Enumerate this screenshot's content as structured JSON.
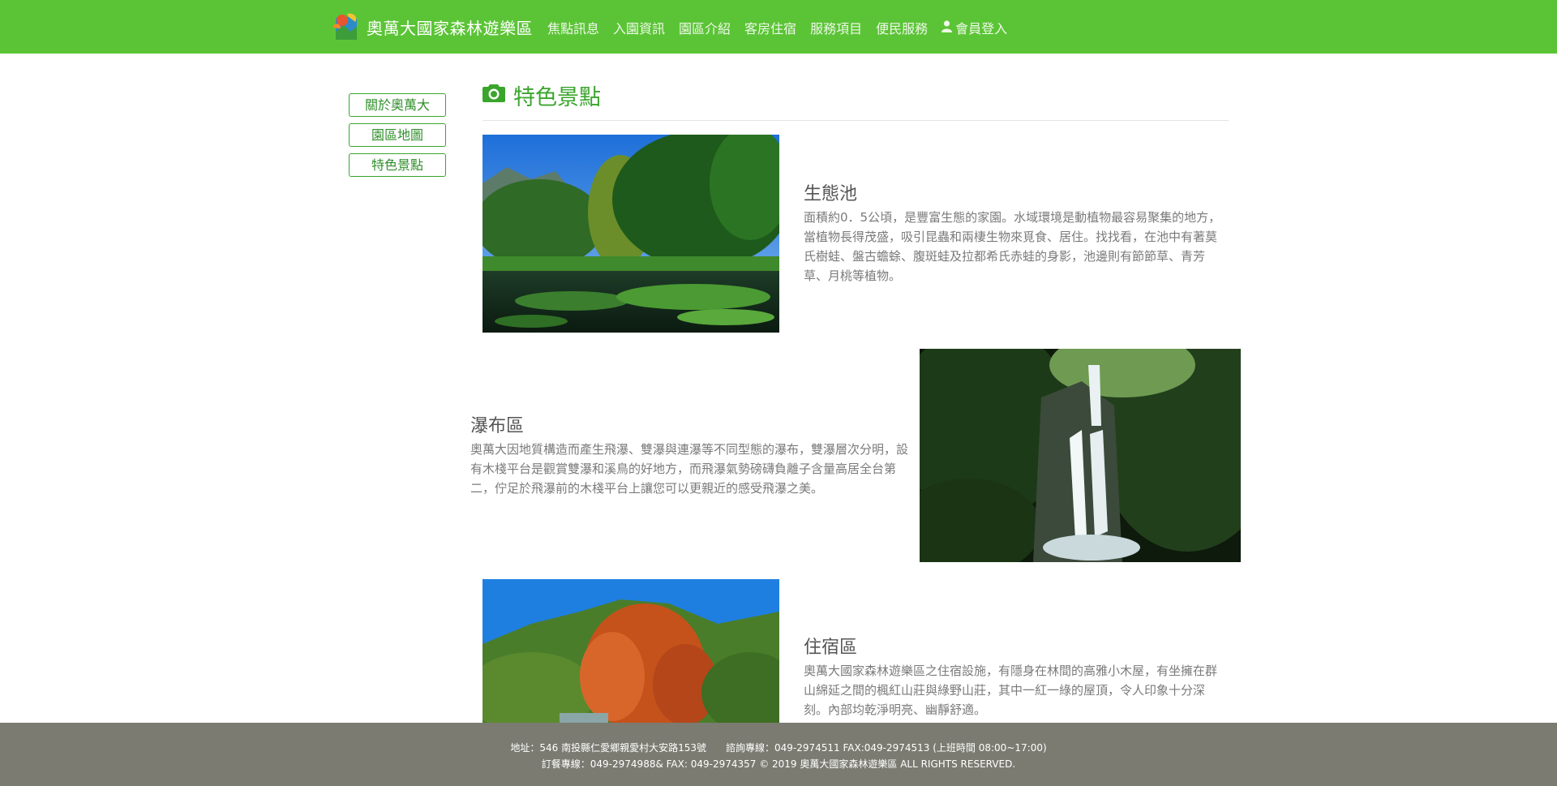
{
  "brand": {
    "name": "奧萬大國家森林遊樂區"
  },
  "nav": {
    "items": [
      "焦點訊息",
      "入園資訊",
      "園區介紹",
      "客房住宿",
      "服務項目",
      "便民服務"
    ],
    "login": "會員登入"
  },
  "sidebar": {
    "items": [
      "關於奧萬大",
      "園區地圖",
      "特色景點"
    ]
  },
  "page": {
    "title": "特色景點"
  },
  "spots": [
    {
      "title": "生態池",
      "desc": "面積約0．5公頃，是豐富生態的家園。水域環境是動植物最容易聚集的地方，當植物長得茂盛，吸引昆蟲和兩棲生物來覓食、居住。找找看，在池中有著莫氏樹蛙、盤古蟾蜍、腹斑蛙及拉都希氏赤蛙的身影，池邊則有節節草、青芳草、月桃等植物。"
    },
    {
      "title": "瀑布區",
      "desc": "奧萬大因地質構造而產生飛瀑、雙瀑與連瀑等不同型態的瀑布，雙瀑層次分明，設有木棧平台是觀賞雙瀑和溪鳥的好地方，而飛瀑氣勢磅礴負離子含量高居全台第二，佇足於飛瀑前的木棧平台上讓您可以更親近的感受飛瀑之美。"
    },
    {
      "title": "住宿區",
      "desc": "奧萬大國家森林遊樂區之住宿設施，有隱身在林間的高雅小木屋，有坐擁在群山綿延之間的楓紅山莊與綠野山莊，其中一紅一綠的屋頂，令人印象十分深刻。內部均乾淨明亮、幽靜舒適。"
    }
  ],
  "footer": {
    "line1": "地址：546 南投縣仁愛鄉親愛村大安路153號　　諮詢專線：049-2974511  FAX:049-2974513 (上班時間 08:00~17:00)",
    "line2": "訂餐專線：049-2974988&  FAX: 049-2974357   © 2019 奧萬大國家森林遊樂區 ALL RIGHTS RESERVED."
  },
  "colors": {
    "header": "#5bc436",
    "accent": "#3aa52c",
    "footer": "#7b7b72"
  },
  "icons": {
    "logo": "park-logo",
    "user": "user-icon",
    "title": "camera-icon"
  }
}
